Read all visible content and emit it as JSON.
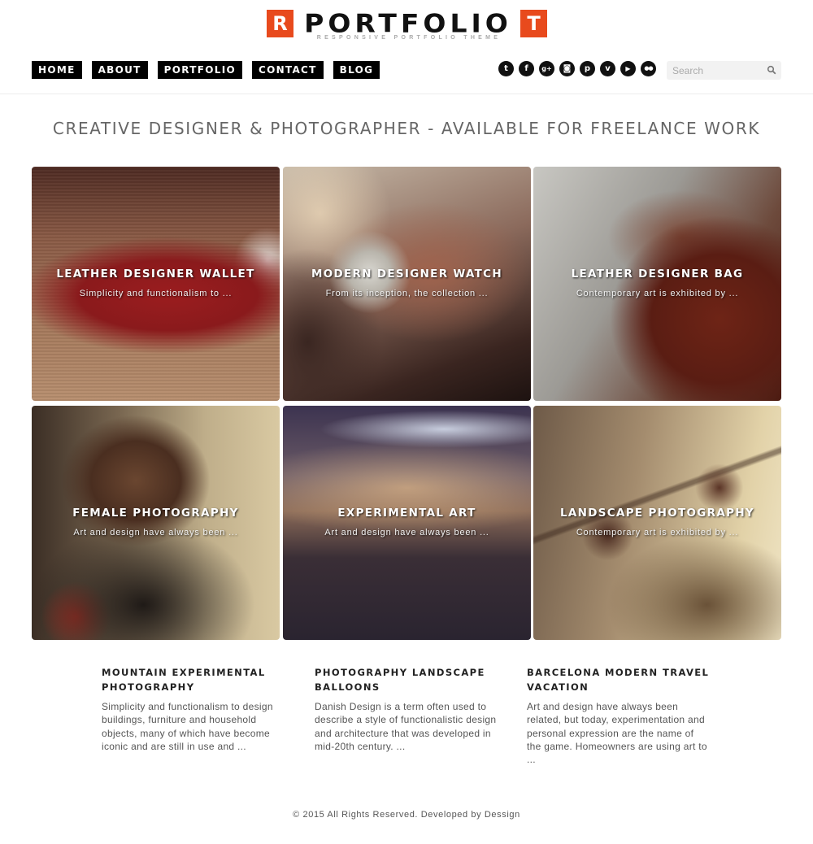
{
  "logo": {
    "left_letter": "R",
    "word": "PORTFOLIO",
    "right_letter": "T",
    "tagline": "RESPONSIVE PORTFOLIO THEME",
    "accent_color": "#e84a1d"
  },
  "nav": {
    "items": [
      {
        "label": "HOME"
      },
      {
        "label": "ABOUT"
      },
      {
        "label": "PORTFOLIO"
      },
      {
        "label": "CONTACT"
      },
      {
        "label": "BLOG"
      }
    ]
  },
  "social": [
    {
      "name": "twitter-icon",
      "glyph": "t"
    },
    {
      "name": "facebook-icon",
      "glyph": "f"
    },
    {
      "name": "google-plus-icon",
      "glyph": "g+"
    },
    {
      "name": "instagram-icon",
      "glyph": "◙"
    },
    {
      "name": "pinterest-icon",
      "glyph": "p"
    },
    {
      "name": "vimeo-icon",
      "glyph": "v"
    },
    {
      "name": "youtube-icon",
      "glyph": "▶"
    },
    {
      "name": "flickr-icon",
      "glyph": "●●"
    }
  ],
  "search": {
    "placeholder": "Search",
    "value": ""
  },
  "headline": "CREATIVE DESIGNER & PHOTOGRAPHER - AVAILABLE FOR FREELANCE WORK",
  "portfolio": [
    {
      "title": "LEATHER DESIGNER WALLET",
      "excerpt": "Simplicity and functionalism to ..."
    },
    {
      "title": "MODERN DESIGNER WATCH",
      "excerpt": "From its inception, the collection ..."
    },
    {
      "title": "LEATHER DESIGNER BAG",
      "excerpt": "Contemporary art is exhibited by ..."
    },
    {
      "title": "FEMALE PHOTOGRAPHY",
      "excerpt": "Art and design have always been ..."
    },
    {
      "title": "EXPERIMENTAL ART",
      "excerpt": "Art and design have always been ..."
    },
    {
      "title": "LANDSCAPE PHOTOGRAPHY",
      "excerpt": "Contemporary art is exhibited by ..."
    }
  ],
  "posts": [
    {
      "title": "MOUNTAIN EXPERIMENTAL PHOTOGRAPHY",
      "excerpt": "Simplicity and functionalism to design buildings, furniture and household objects, many of which have become iconic and are still in use and ..."
    },
    {
      "title": "PHOTOGRAPHY LANDSCAPE BALLOONS",
      "excerpt": "Danish Design is a term often used to describe a style of functionalistic design and architecture that was developed in mid-20th century. ..."
    },
    {
      "title": "BARCELONA MODERN TRAVEL VACATION",
      "excerpt": "Art and design have always been related, but today, experimentation and personal expression are the name of the game. Homeowners are using art to ..."
    }
  ],
  "footer": {
    "text": "© 2015 All Rights Reserved. Developed by ",
    "link": "Dessign"
  }
}
